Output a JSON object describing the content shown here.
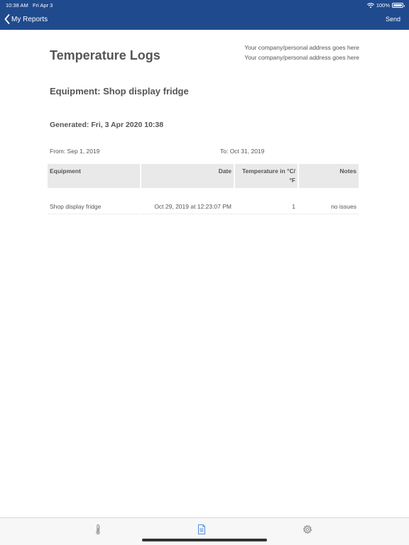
{
  "status_bar": {
    "time": "10:38 AM",
    "date": "Fri Apr 3",
    "battery": "100%",
    "battery_level": 1.0,
    "wifi_icon": "wifi-icon"
  },
  "nav": {
    "back_label": "My Reports",
    "send_label": "Send"
  },
  "document": {
    "title": "Temperature Logs",
    "address_line_1": "Your company/personal address goes here",
    "address_line_2": "Your company/personal address goes here",
    "equipment": "Equipment: Shop display fridge",
    "generated": "Generated: Fri, 3 Apr 2020 10:38",
    "from": "From: Sep 1, 2019",
    "to": "To: Oct 31, 2019"
  },
  "table": {
    "headers": {
      "equipment": "Equipment",
      "date": "Date",
      "temperature": "Temperature in °C/ °F",
      "notes": "Notes"
    },
    "rows": [
      {
        "equipment": "Shop display fridge",
        "date": "Oct 29, 2019 at 12:23:07 PM",
        "temperature": "1",
        "notes": "no issues"
      }
    ]
  },
  "tabs": [
    {
      "icon": "thermometer-icon",
      "active": false
    },
    {
      "icon": "document-icon",
      "active": true
    },
    {
      "icon": "gear-icon",
      "active": false
    }
  ],
  "colors": {
    "nav_background": "#1f4a8e",
    "active_tab": "#4a8fe7",
    "inactive_tab": "#8e8e93",
    "text": "#555555"
  }
}
